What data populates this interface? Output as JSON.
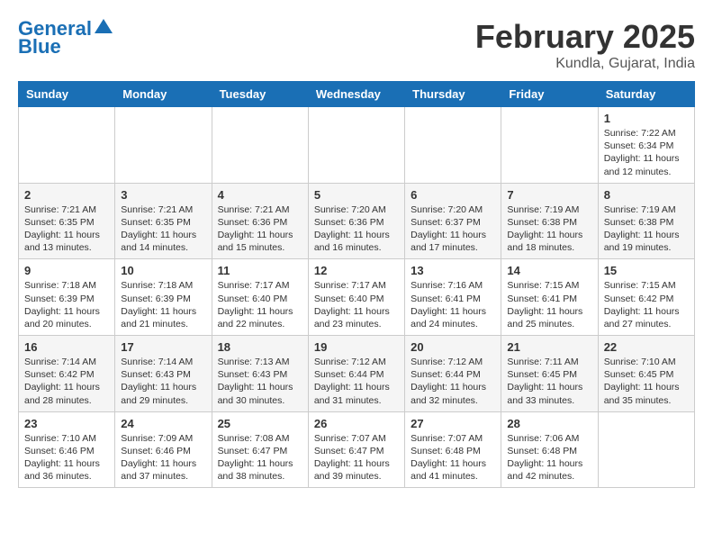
{
  "header": {
    "logo_line1": "General",
    "logo_line2": "Blue",
    "month_title": "February 2025",
    "location": "Kundla, Gujarat, India"
  },
  "days_of_week": [
    "Sunday",
    "Monday",
    "Tuesday",
    "Wednesday",
    "Thursday",
    "Friday",
    "Saturday"
  ],
  "weeks": [
    [
      {
        "day": "",
        "info": ""
      },
      {
        "day": "",
        "info": ""
      },
      {
        "day": "",
        "info": ""
      },
      {
        "day": "",
        "info": ""
      },
      {
        "day": "",
        "info": ""
      },
      {
        "day": "",
        "info": ""
      },
      {
        "day": "1",
        "info": "Sunrise: 7:22 AM\nSunset: 6:34 PM\nDaylight: 11 hours and 12 minutes."
      }
    ],
    [
      {
        "day": "2",
        "info": "Sunrise: 7:21 AM\nSunset: 6:35 PM\nDaylight: 11 hours and 13 minutes."
      },
      {
        "day": "3",
        "info": "Sunrise: 7:21 AM\nSunset: 6:35 PM\nDaylight: 11 hours and 14 minutes."
      },
      {
        "day": "4",
        "info": "Sunrise: 7:21 AM\nSunset: 6:36 PM\nDaylight: 11 hours and 15 minutes."
      },
      {
        "day": "5",
        "info": "Sunrise: 7:20 AM\nSunset: 6:36 PM\nDaylight: 11 hours and 16 minutes."
      },
      {
        "day": "6",
        "info": "Sunrise: 7:20 AM\nSunset: 6:37 PM\nDaylight: 11 hours and 17 minutes."
      },
      {
        "day": "7",
        "info": "Sunrise: 7:19 AM\nSunset: 6:38 PM\nDaylight: 11 hours and 18 minutes."
      },
      {
        "day": "8",
        "info": "Sunrise: 7:19 AM\nSunset: 6:38 PM\nDaylight: 11 hours and 19 minutes."
      }
    ],
    [
      {
        "day": "9",
        "info": "Sunrise: 7:18 AM\nSunset: 6:39 PM\nDaylight: 11 hours and 20 minutes."
      },
      {
        "day": "10",
        "info": "Sunrise: 7:18 AM\nSunset: 6:39 PM\nDaylight: 11 hours and 21 minutes."
      },
      {
        "day": "11",
        "info": "Sunrise: 7:17 AM\nSunset: 6:40 PM\nDaylight: 11 hours and 22 minutes."
      },
      {
        "day": "12",
        "info": "Sunrise: 7:17 AM\nSunset: 6:40 PM\nDaylight: 11 hours and 23 minutes."
      },
      {
        "day": "13",
        "info": "Sunrise: 7:16 AM\nSunset: 6:41 PM\nDaylight: 11 hours and 24 minutes."
      },
      {
        "day": "14",
        "info": "Sunrise: 7:15 AM\nSunset: 6:41 PM\nDaylight: 11 hours and 25 minutes."
      },
      {
        "day": "15",
        "info": "Sunrise: 7:15 AM\nSunset: 6:42 PM\nDaylight: 11 hours and 27 minutes."
      }
    ],
    [
      {
        "day": "16",
        "info": "Sunrise: 7:14 AM\nSunset: 6:42 PM\nDaylight: 11 hours and 28 minutes."
      },
      {
        "day": "17",
        "info": "Sunrise: 7:14 AM\nSunset: 6:43 PM\nDaylight: 11 hours and 29 minutes."
      },
      {
        "day": "18",
        "info": "Sunrise: 7:13 AM\nSunset: 6:43 PM\nDaylight: 11 hours and 30 minutes."
      },
      {
        "day": "19",
        "info": "Sunrise: 7:12 AM\nSunset: 6:44 PM\nDaylight: 11 hours and 31 minutes."
      },
      {
        "day": "20",
        "info": "Sunrise: 7:12 AM\nSunset: 6:44 PM\nDaylight: 11 hours and 32 minutes."
      },
      {
        "day": "21",
        "info": "Sunrise: 7:11 AM\nSunset: 6:45 PM\nDaylight: 11 hours and 33 minutes."
      },
      {
        "day": "22",
        "info": "Sunrise: 7:10 AM\nSunset: 6:45 PM\nDaylight: 11 hours and 35 minutes."
      }
    ],
    [
      {
        "day": "23",
        "info": "Sunrise: 7:10 AM\nSunset: 6:46 PM\nDaylight: 11 hours and 36 minutes."
      },
      {
        "day": "24",
        "info": "Sunrise: 7:09 AM\nSunset: 6:46 PM\nDaylight: 11 hours and 37 minutes."
      },
      {
        "day": "25",
        "info": "Sunrise: 7:08 AM\nSunset: 6:47 PM\nDaylight: 11 hours and 38 minutes."
      },
      {
        "day": "26",
        "info": "Sunrise: 7:07 AM\nSunset: 6:47 PM\nDaylight: 11 hours and 39 minutes."
      },
      {
        "day": "27",
        "info": "Sunrise: 7:07 AM\nSunset: 6:48 PM\nDaylight: 11 hours and 41 minutes."
      },
      {
        "day": "28",
        "info": "Sunrise: 7:06 AM\nSunset: 6:48 PM\nDaylight: 11 hours and 42 minutes."
      },
      {
        "day": "",
        "info": ""
      }
    ]
  ]
}
